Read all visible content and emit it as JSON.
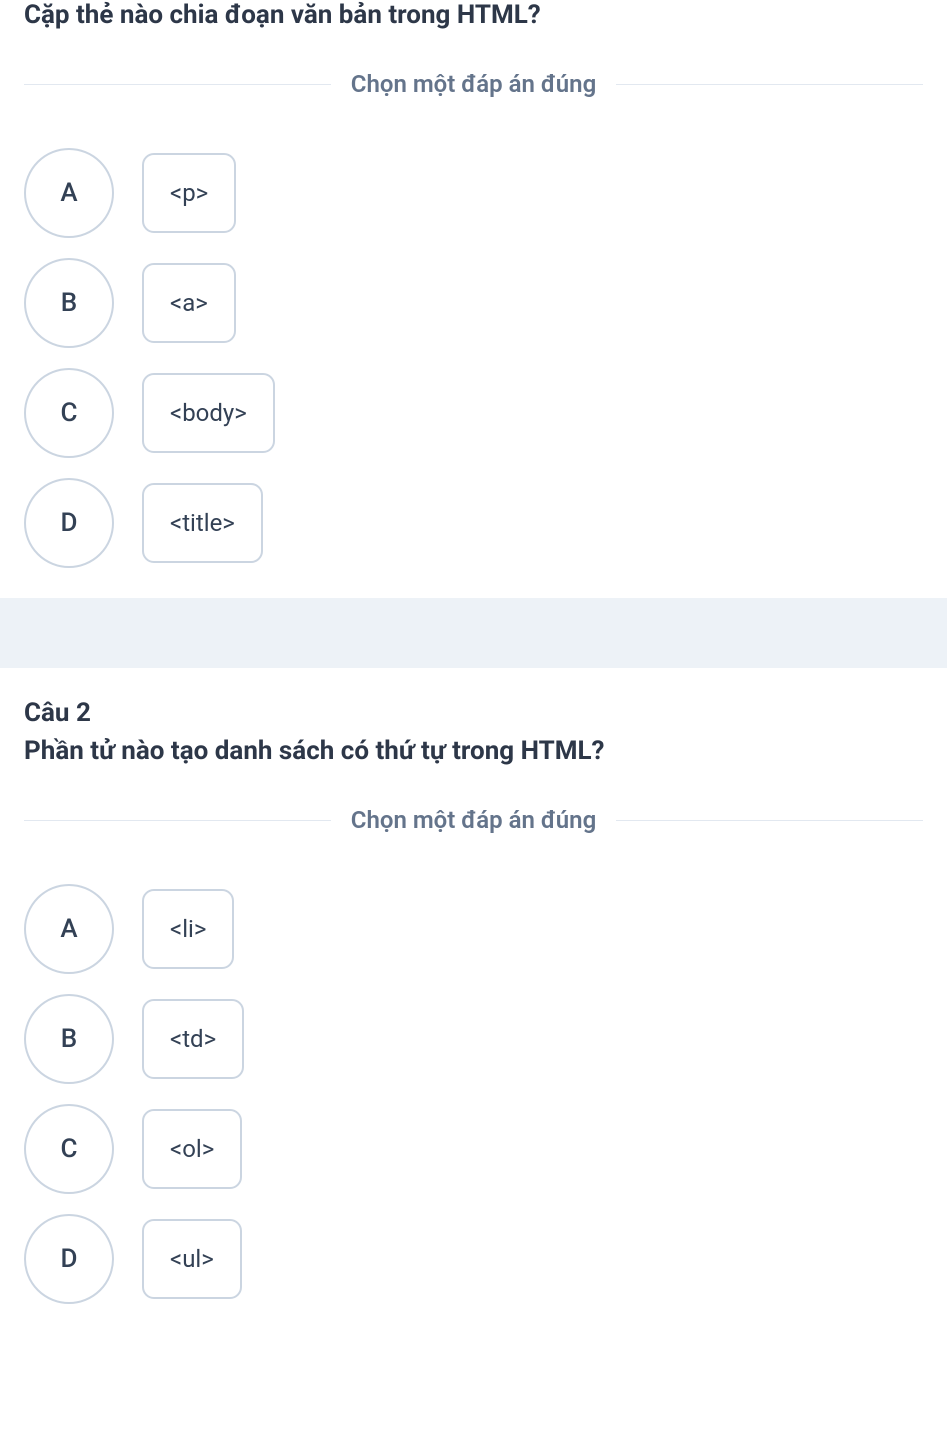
{
  "instruction": "Chọn một đáp án đúng",
  "questions": [
    {
      "number": "",
      "text": "Cặp thẻ nào chia đoạn văn bản trong HTML?",
      "options": [
        {
          "letter": "A",
          "value": "<p>"
        },
        {
          "letter": "B",
          "value": "<a>"
        },
        {
          "letter": "C",
          "value": "<body>"
        },
        {
          "letter": "D",
          "value": "<title>"
        }
      ]
    },
    {
      "number": "Câu 2",
      "text": "Phần tử nào tạo danh sách có thứ tự trong HTML?",
      "options": [
        {
          "letter": "A",
          "value": "<li>"
        },
        {
          "letter": "B",
          "value": "<td>"
        },
        {
          "letter": "C",
          "value": "<ol>"
        },
        {
          "letter": "D",
          "value": "<ul>"
        }
      ]
    }
  ]
}
